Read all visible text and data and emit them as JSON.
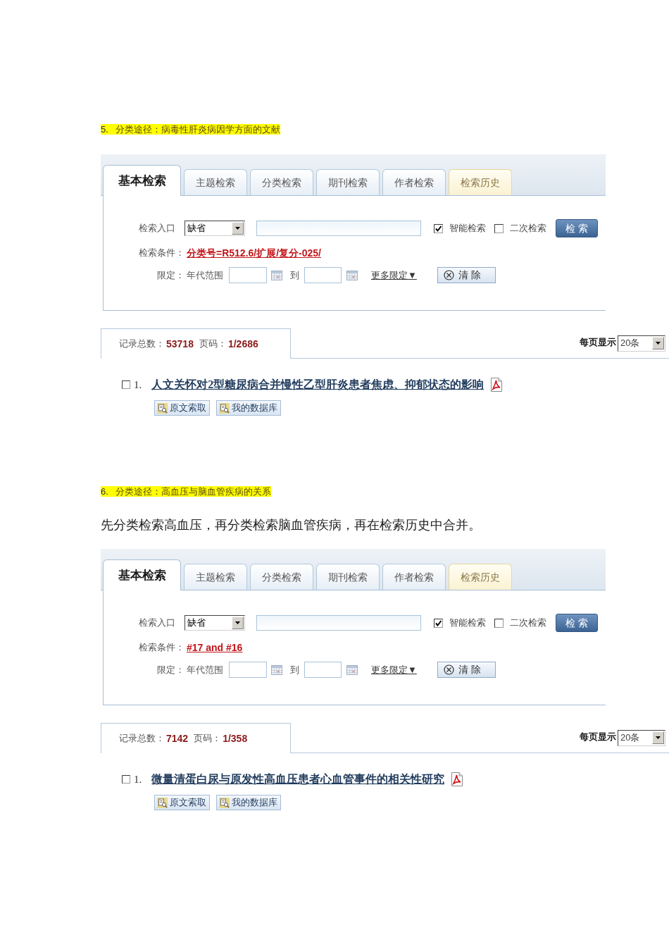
{
  "sections": [
    {
      "heading": {
        "number": "5.",
        "title": "分类途径：病毒性肝炎病因学方面的文献"
      },
      "search_panel": {
        "tabs": [
          {
            "label": "基本检索",
            "selected": true,
            "kind": "search"
          },
          {
            "label": "主题检索",
            "selected": false,
            "kind": "search"
          },
          {
            "label": "分类检索",
            "selected": false,
            "kind": "search"
          },
          {
            "label": "期刊检索",
            "selected": false,
            "kind": "search"
          },
          {
            "label": "作者检索",
            "selected": false,
            "kind": "search"
          },
          {
            "label": "检索历史",
            "selected": false,
            "kind": "history"
          }
        ],
        "entry_label": "检索入口",
        "entry_select": "缺省",
        "options": [
          {
            "label": "智能检索",
            "checked": true
          },
          {
            "label": "二次检索",
            "checked": false
          }
        ],
        "search_button": "检 索",
        "condition_label": "检索条件：",
        "condition": "分类号=R512.6/扩展/复分-025/",
        "limit_label": "限定：",
        "year_label": "年代范围",
        "to_label": "到",
        "more_limits": "更多限定▼",
        "clear_button": "清 除"
      },
      "results": {
        "total_label": "记录总数：",
        "total": "53718",
        "page_label": "页码：",
        "page": "1/2686",
        "per_page_label": "每页显示",
        "per_page": "20条",
        "items": [
          {
            "checked": false,
            "number": "1.",
            "title": "人文关怀对2型糖尿病合并慢性乙型肝炎患者焦虑、抑郁状态的影响",
            "actions": [
              "原文索取",
              "我的数据库"
            ]
          }
        ]
      }
    },
    {
      "heading": {
        "number": "6.",
        "title": "分类途径：高血压与脑血管疾病的关系"
      },
      "intro": "先分类检索高血压，再分类检索脑血管疾病，再在检索历史中合并。",
      "search_panel": {
        "tabs": [
          {
            "label": "基本检索",
            "selected": true,
            "kind": "search"
          },
          {
            "label": "主题检索",
            "selected": false,
            "kind": "search"
          },
          {
            "label": "分类检索",
            "selected": false,
            "kind": "search"
          },
          {
            "label": "期刊检索",
            "selected": false,
            "kind": "search"
          },
          {
            "label": "作者检索",
            "selected": false,
            "kind": "search"
          },
          {
            "label": "检索历史",
            "selected": false,
            "kind": "history"
          }
        ],
        "entry_label": "检索入口",
        "entry_select": "缺省",
        "options": [
          {
            "label": "智能检索",
            "checked": true
          },
          {
            "label": "二次检索",
            "checked": false
          }
        ],
        "search_button": "检 索",
        "condition_label": "检索条件：",
        "condition": "#17 and #16",
        "limit_label": "限定：",
        "year_label": "年代范围",
        "to_label": "到",
        "more_limits": "更多限定▼",
        "clear_button": "清 除"
      },
      "results": {
        "total_label": "记录总数：",
        "total": "7142",
        "page_label": "页码：",
        "page": "1/358",
        "per_page_label": "每页显示",
        "per_page": "20条",
        "items": [
          {
            "checked": false,
            "number": "1.",
            "title": "微量清蛋白尿与原发性高血压患者心血管事件的相关性研究",
            "actions": [
              "原文索取",
              "我的数据库"
            ]
          }
        ]
      }
    }
  ]
}
